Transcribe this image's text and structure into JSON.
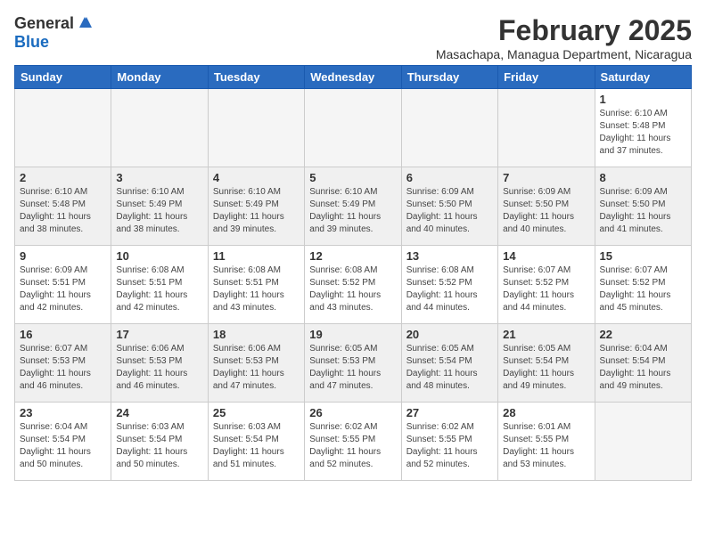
{
  "header": {
    "logo_general": "General",
    "logo_blue": "Blue",
    "month_year": "February 2025",
    "location": "Masachapa, Managua Department, Nicaragua"
  },
  "weekdays": [
    "Sunday",
    "Monday",
    "Tuesday",
    "Wednesday",
    "Thursday",
    "Friday",
    "Saturday"
  ],
  "weeks": [
    [
      {
        "day": "",
        "info": ""
      },
      {
        "day": "",
        "info": ""
      },
      {
        "day": "",
        "info": ""
      },
      {
        "day": "",
        "info": ""
      },
      {
        "day": "",
        "info": ""
      },
      {
        "day": "",
        "info": ""
      },
      {
        "day": "1",
        "info": "Sunrise: 6:10 AM\nSunset: 5:48 PM\nDaylight: 11 hours\nand 37 minutes."
      }
    ],
    [
      {
        "day": "2",
        "info": "Sunrise: 6:10 AM\nSunset: 5:48 PM\nDaylight: 11 hours\nand 38 minutes."
      },
      {
        "day": "3",
        "info": "Sunrise: 6:10 AM\nSunset: 5:49 PM\nDaylight: 11 hours\nand 38 minutes."
      },
      {
        "day": "4",
        "info": "Sunrise: 6:10 AM\nSunset: 5:49 PM\nDaylight: 11 hours\nand 39 minutes."
      },
      {
        "day": "5",
        "info": "Sunrise: 6:10 AM\nSunset: 5:49 PM\nDaylight: 11 hours\nand 39 minutes."
      },
      {
        "day": "6",
        "info": "Sunrise: 6:09 AM\nSunset: 5:50 PM\nDaylight: 11 hours\nand 40 minutes."
      },
      {
        "day": "7",
        "info": "Sunrise: 6:09 AM\nSunset: 5:50 PM\nDaylight: 11 hours\nand 40 minutes."
      },
      {
        "day": "8",
        "info": "Sunrise: 6:09 AM\nSunset: 5:50 PM\nDaylight: 11 hours\nand 41 minutes."
      }
    ],
    [
      {
        "day": "9",
        "info": "Sunrise: 6:09 AM\nSunset: 5:51 PM\nDaylight: 11 hours\nand 42 minutes."
      },
      {
        "day": "10",
        "info": "Sunrise: 6:08 AM\nSunset: 5:51 PM\nDaylight: 11 hours\nand 42 minutes."
      },
      {
        "day": "11",
        "info": "Sunrise: 6:08 AM\nSunset: 5:51 PM\nDaylight: 11 hours\nand 43 minutes."
      },
      {
        "day": "12",
        "info": "Sunrise: 6:08 AM\nSunset: 5:52 PM\nDaylight: 11 hours\nand 43 minutes."
      },
      {
        "day": "13",
        "info": "Sunrise: 6:08 AM\nSunset: 5:52 PM\nDaylight: 11 hours\nand 44 minutes."
      },
      {
        "day": "14",
        "info": "Sunrise: 6:07 AM\nSunset: 5:52 PM\nDaylight: 11 hours\nand 44 minutes."
      },
      {
        "day": "15",
        "info": "Sunrise: 6:07 AM\nSunset: 5:52 PM\nDaylight: 11 hours\nand 45 minutes."
      }
    ],
    [
      {
        "day": "16",
        "info": "Sunrise: 6:07 AM\nSunset: 5:53 PM\nDaylight: 11 hours\nand 46 minutes."
      },
      {
        "day": "17",
        "info": "Sunrise: 6:06 AM\nSunset: 5:53 PM\nDaylight: 11 hours\nand 46 minutes."
      },
      {
        "day": "18",
        "info": "Sunrise: 6:06 AM\nSunset: 5:53 PM\nDaylight: 11 hours\nand 47 minutes."
      },
      {
        "day": "19",
        "info": "Sunrise: 6:05 AM\nSunset: 5:53 PM\nDaylight: 11 hours\nand 47 minutes."
      },
      {
        "day": "20",
        "info": "Sunrise: 6:05 AM\nSunset: 5:54 PM\nDaylight: 11 hours\nand 48 minutes."
      },
      {
        "day": "21",
        "info": "Sunrise: 6:05 AM\nSunset: 5:54 PM\nDaylight: 11 hours\nand 49 minutes."
      },
      {
        "day": "22",
        "info": "Sunrise: 6:04 AM\nSunset: 5:54 PM\nDaylight: 11 hours\nand 49 minutes."
      }
    ],
    [
      {
        "day": "23",
        "info": "Sunrise: 6:04 AM\nSunset: 5:54 PM\nDaylight: 11 hours\nand 50 minutes."
      },
      {
        "day": "24",
        "info": "Sunrise: 6:03 AM\nSunset: 5:54 PM\nDaylight: 11 hours\nand 50 minutes."
      },
      {
        "day": "25",
        "info": "Sunrise: 6:03 AM\nSunset: 5:54 PM\nDaylight: 11 hours\nand 51 minutes."
      },
      {
        "day": "26",
        "info": "Sunrise: 6:02 AM\nSunset: 5:55 PM\nDaylight: 11 hours\nand 52 minutes."
      },
      {
        "day": "27",
        "info": "Sunrise: 6:02 AM\nSunset: 5:55 PM\nDaylight: 11 hours\nand 52 minutes."
      },
      {
        "day": "28",
        "info": "Sunrise: 6:01 AM\nSunset: 5:55 PM\nDaylight: 11 hours\nand 53 minutes."
      },
      {
        "day": "",
        "info": ""
      }
    ]
  ]
}
